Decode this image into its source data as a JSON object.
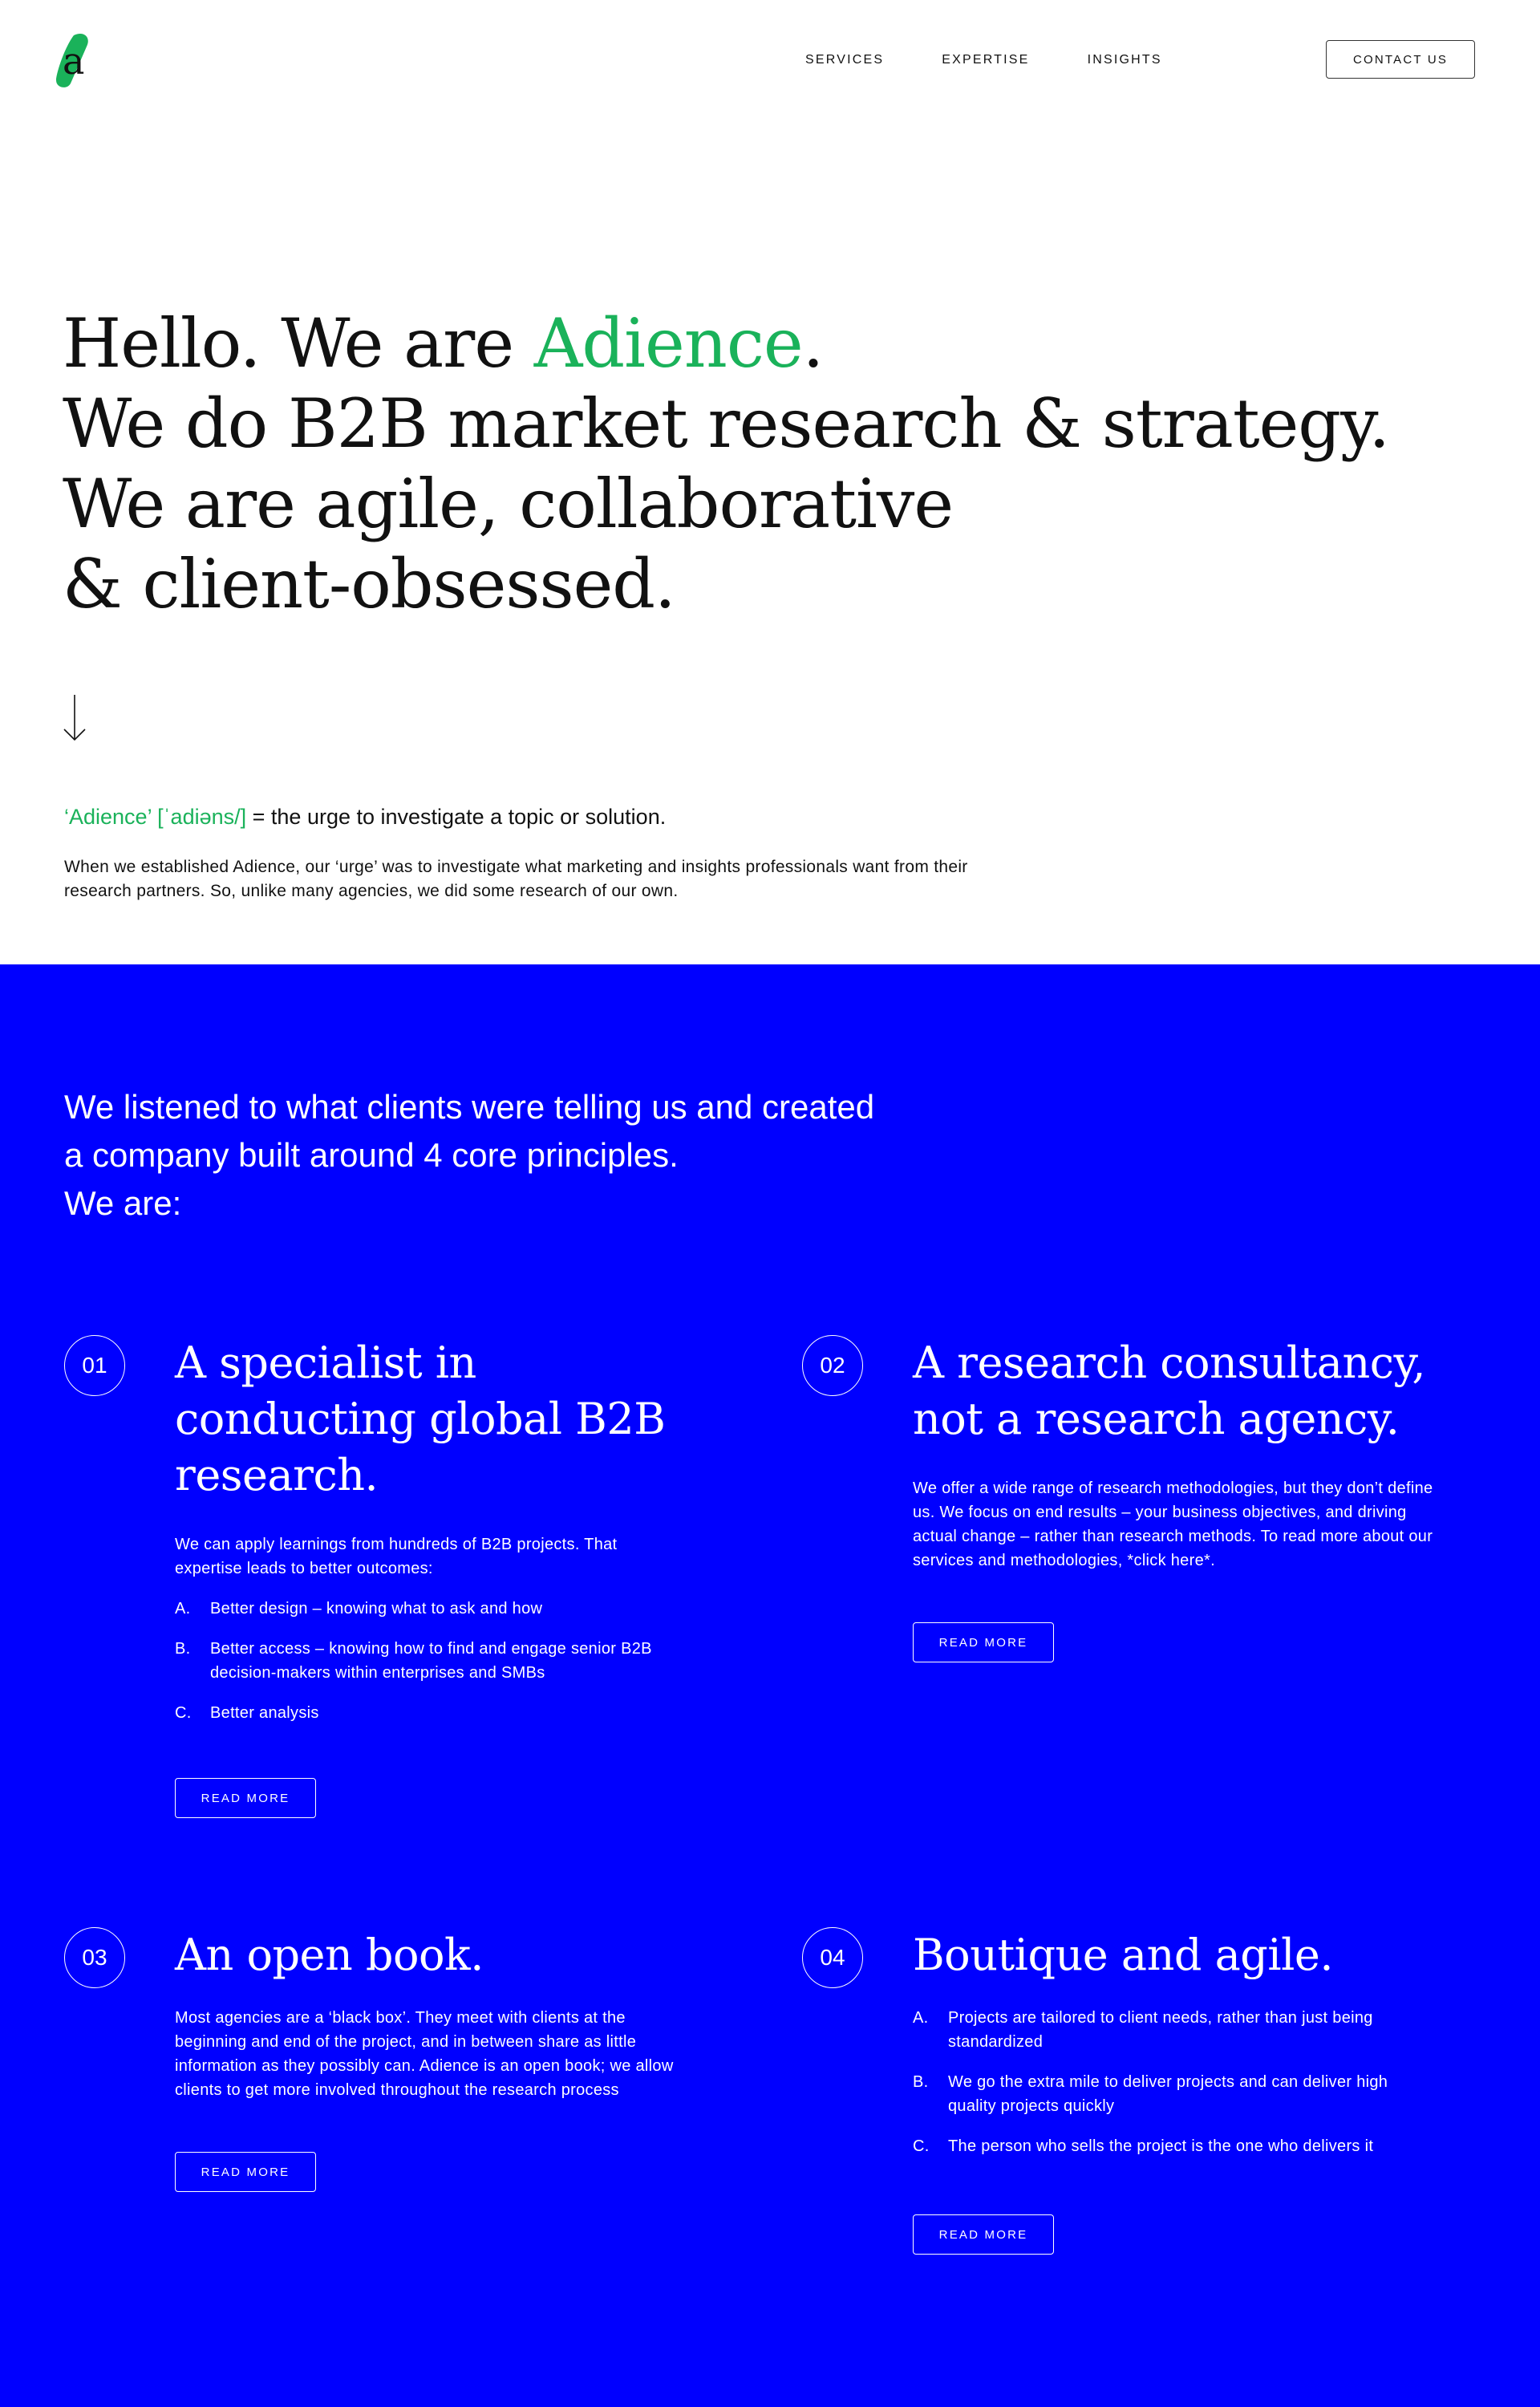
{
  "header": {
    "logo_letter": "a",
    "nav": [
      "SERVICES",
      "EXPERTISE",
      "INSIGHTS"
    ],
    "contact_label": "CONTACT US"
  },
  "hero": {
    "line1_prefix": "Hello. We are ",
    "line1_accent": "Adience",
    "line1_suffix": ".",
    "line2": "We do B2B market research & strategy.",
    "line3": "We are agile, collaborative",
    "line4": "& client-obsessed.",
    "arrow_icon": "arrow-down-icon"
  },
  "definition": {
    "term": "‘Adience’ [ˈadiəns/]",
    "meaning": " = the urge to investigate a topic or solution."
  },
  "intro_text": "When we established Adience, our ‘urge’ was to investigate what marketing and insights professionals want from their research partners. So, unlike many agencies, we did some research of our own.",
  "principles_intro": {
    "line1": "We listened to what clients were telling us and created",
    "line2": "a company built around 4 core principles.",
    "line3": "We are:"
  },
  "principles": [
    {
      "number": "01",
      "title": "A specialist in conducting global B2B research.",
      "text": "We can apply learnings from hundreds of B2B projects. That expertise leads to better outcomes:",
      "list": [
        {
          "letter": "A.",
          "text": "Better design – knowing what to ask and how"
        },
        {
          "letter": "B.",
          "text": "Better access – knowing how to find and engage senior B2B decision-makers within enterprises and SMBs"
        },
        {
          "letter": "C.",
          "text": "Better analysis"
        }
      ],
      "button": "READ MORE"
    },
    {
      "number": "02",
      "title": "A research consultancy, not a research agency.",
      "text": "We offer a wide range of research methodologies, but they don’t define us. We focus on end results – your business objectives, and driving actual change – rather than research methods. To read more about our services and methodologies, *click here*.",
      "list": [],
      "button": "READ MORE"
    },
    {
      "number": "03",
      "title": "An open book.",
      "text": "Most agencies are a ‘black box’. They meet with clients at the beginning and end of the project, and in between share as little information as they possibly can. Adience is an open book; we allow clients to get more involved throughout the research process",
      "list": [],
      "button": "READ MORE"
    },
    {
      "number": "04",
      "title": "Boutique and agile.",
      "text": "",
      "list": [
        {
          "letter": "A.",
          "text": "Projects are tailored to client needs, rather than just being standardized"
        },
        {
          "letter": "B.",
          "text": "We go the extra mile to deliver projects and can deliver high quality projects quickly"
        },
        {
          "letter": "C.",
          "text": "The person who sells the project is the one who delivers it"
        }
      ],
      "button": "READ MORE"
    }
  ],
  "colors": {
    "accent_green": "#1ab25a",
    "section_blue": "#0000ff",
    "text_dark": "#111111"
  }
}
